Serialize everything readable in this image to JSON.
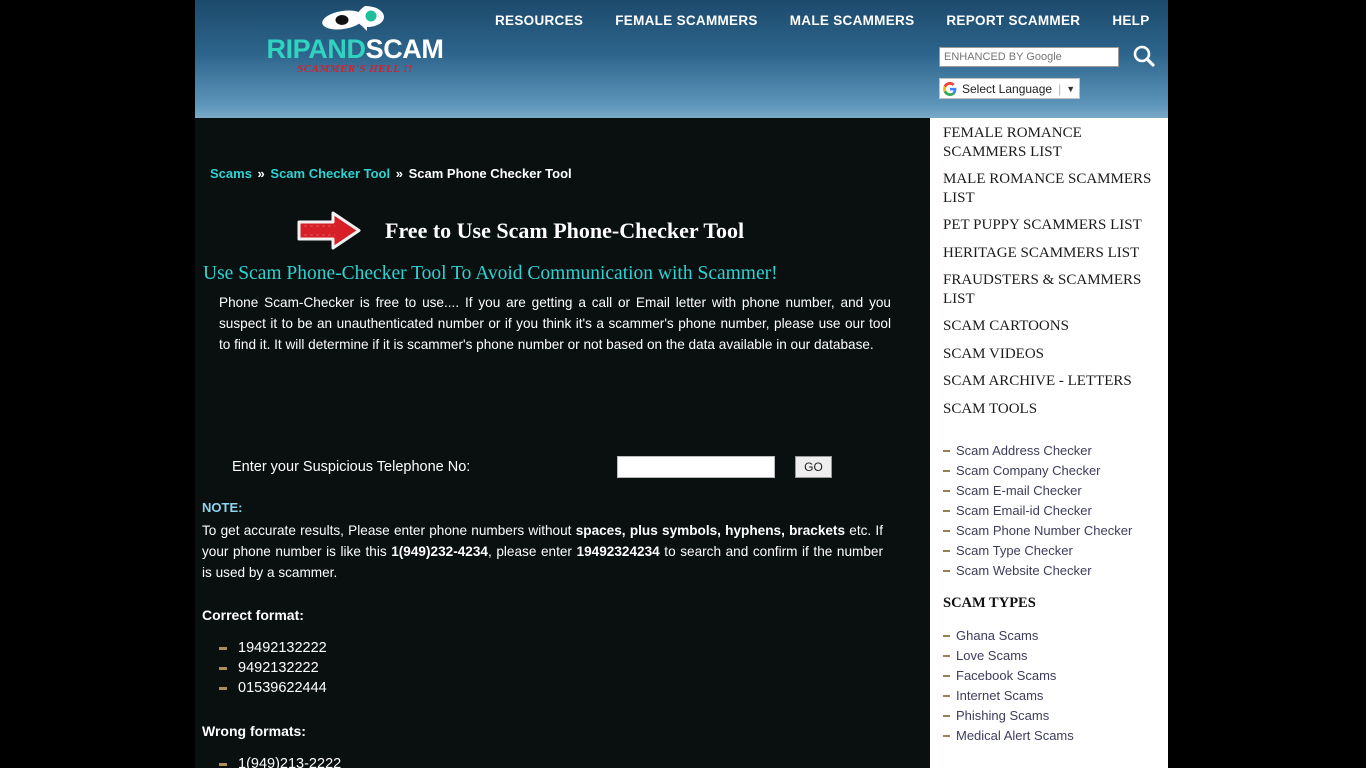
{
  "site": {
    "logo": {
      "word_first": "RIPAND",
      "word_second": "SCAM",
      "tagline": "SCAMMER'S HELL !!"
    },
    "nav": [
      {
        "label": "RESOURCES"
      },
      {
        "label": "FEMALE SCAMMERS"
      },
      {
        "label": "MALE SCAMMERS"
      },
      {
        "label": "REPORT SCAMMER"
      },
      {
        "label": "HELP"
      }
    ],
    "search": {
      "placeholder": "ENHANCED BY Google",
      "value": ""
    },
    "language": {
      "label": "Select Language",
      "caret": "▼"
    },
    "colors": {
      "header_top": "#1c4a6c",
      "header_bottom": "#7aaac9",
      "accent_cyan": "#2fd3d3",
      "logo_teal": "#2fd3c0",
      "tagline_red": "#d81f2a",
      "note_blue": "#8fd4f0",
      "content_bg": "#0a0f10",
      "sidebar_bg": "#ffffff",
      "bullet_tan": "#b08d5a"
    }
  },
  "breadcrumb": {
    "items": [
      {
        "label": "Scams",
        "type": "link"
      },
      {
        "label": "»",
        "type": "separator"
      },
      {
        "label": "Scam Checker Tool",
        "type": "link"
      },
      {
        "label": "»",
        "type": "separator"
      },
      {
        "label": "Scam Phone Checker Tool",
        "type": "current"
      }
    ]
  },
  "main": {
    "title": "Free to Use Scam Phone-Checker Tool",
    "subtitle": "Use Scam Phone-Checker Tool To Avoid Communication with Scammer!",
    "intro": "Phone Scam-Checker is free to use.... If you are getting a call or Email letter with phone number, and you suspect it to be an unauthenticated number or if you think it's a scammer's phone number, please use our tool to find it. It will determine if it is scammer's phone number or not based on the data available in our database.",
    "form": {
      "label": "Enter your Suspicious Telephone No:",
      "input_value": "",
      "input_placeholder": "",
      "button_label": "GO"
    },
    "note": {
      "label": "NOTE:",
      "text_part1": "To get accurate results, Please enter phone numbers without ",
      "bold1": "spaces, plus symbols, hyphens, brackets",
      "text_part2": " etc. If your phone number is like this ",
      "bold2": "1(949)232-4234",
      "text_part3": ", please enter ",
      "bold3": "19492324234",
      "text_part4": " to search and confirm if the number is used by a scammer."
    },
    "correct_format": {
      "heading": "Correct format:",
      "items": [
        "19492132222",
        "9492132222",
        "01539622444"
      ]
    },
    "wrong_format": {
      "heading": "Wrong formats:",
      "items": [
        "1(949)213-2222"
      ]
    }
  },
  "sidebar": {
    "headings": [
      {
        "label": "FEMALE ROMANCE SCAMMERS LIST"
      },
      {
        "label": "MALE ROMANCE SCAMMERS LIST"
      },
      {
        "label": "PET PUPPY SCAMMERS LIST"
      },
      {
        "label": "HERITAGE SCAMMERS LIST"
      },
      {
        "label": "FRAUDSTERS & SCAMMERS LIST"
      },
      {
        "label": "SCAM CARTOONS"
      },
      {
        "label": "SCAM VIDEOS"
      },
      {
        "label": "SCAM ARCHIVE - LETTERS"
      },
      {
        "label": "SCAM TOOLS"
      }
    ],
    "tools": [
      {
        "label": "Scam Address Checker"
      },
      {
        "label": "Scam Company Checker"
      },
      {
        "label": "Scam E-mail Checker"
      },
      {
        "label": "Scam Email-id Checker"
      },
      {
        "label": "Scam Phone Number Checker"
      },
      {
        "label": "Scam Type Checker"
      },
      {
        "label": "Scam Website Checker"
      }
    ],
    "scam_types_heading": "SCAM TYPES",
    "scam_types": [
      {
        "label": "Ghana Scams"
      },
      {
        "label": "Love Scams"
      },
      {
        "label": "Facebook Scams"
      },
      {
        "label": "Internet Scams"
      },
      {
        "label": "Phishing Scams"
      },
      {
        "label": "Medical Alert Scams"
      }
    ]
  }
}
